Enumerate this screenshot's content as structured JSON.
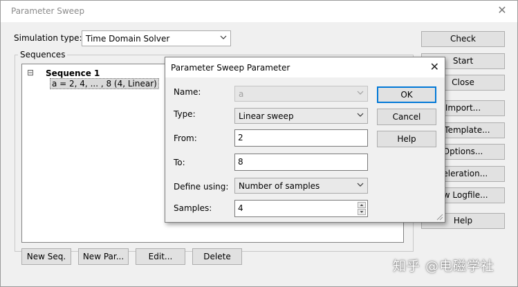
{
  "window": {
    "title": "Parameter Sweep"
  },
  "simulation": {
    "label": "Simulation type:",
    "value": "Time Domain Solver"
  },
  "sequences": {
    "group_label": "Sequences",
    "expander": "⊟",
    "sequence_name": "Sequence 1",
    "parameter_entry": "a = 2, 4, ... , 8 (4, Linear)"
  },
  "bottom_buttons": {
    "new_seq": "New Seq.",
    "new_par": "New Par...",
    "edit": "Edit...",
    "delete": "Delete"
  },
  "side_buttons": {
    "check": "Check",
    "start": "Start",
    "close": "Close",
    "import": "Import...",
    "result_template": "lt Template...",
    "options": "Options...",
    "acceleration": "celeration...",
    "view_logfile": "ew Logfile...",
    "help": "Help"
  },
  "dialog": {
    "title": "Parameter Sweep Parameter",
    "name": {
      "label": "Name:",
      "value": "a"
    },
    "type": {
      "label": "Type:",
      "value": "Linear sweep"
    },
    "from": {
      "label": "From:",
      "value": "2"
    },
    "to": {
      "label": "To:",
      "value": "8"
    },
    "define_using": {
      "label": "Define using:",
      "value": "Number of samples"
    },
    "samples": {
      "label": "Samples:",
      "value": "4"
    },
    "ok": "OK",
    "cancel": "Cancel",
    "help": "Help"
  },
  "watermark": "知乎 @电磁学社",
  "colors": {
    "selection": "#cce4f7",
    "default_button_border": "#0078d7",
    "disabled_text": "#a0a0a0"
  }
}
